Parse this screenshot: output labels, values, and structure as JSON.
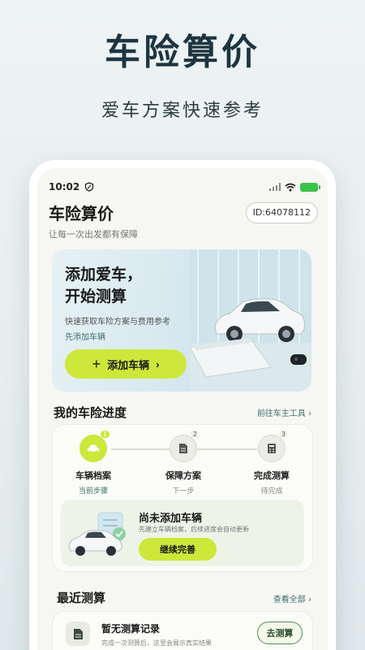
{
  "promo": {
    "title": "车险算价",
    "subtitle": "爱车方案快速参考"
  },
  "status_bar": {
    "time": "10:02"
  },
  "header": {
    "title": "车险算价",
    "id_badge": "ID:64078112",
    "subtitle": "让每一次出发都有保障"
  },
  "banner": {
    "title_line1": "添加爱车，",
    "title_line2": "开始测算",
    "description": "快速获取车险方案与费用参考",
    "link": "先添加车辆",
    "button_label": "添加车辆",
    "button_plus": "+",
    "button_chevron": "›"
  },
  "progress": {
    "section_title": "我的车险进度",
    "link": "前往车主工具 ›",
    "steps": [
      {
        "num": "1",
        "label": "车辆档案",
        "status": "当前步骤",
        "icon": "car-icon",
        "active": true
      },
      {
        "num": "2",
        "label": "保障方案",
        "status": "下一步",
        "icon": "document-icon",
        "active": false
      },
      {
        "num": "3",
        "label": "完成测算",
        "status": "待完成",
        "icon": "calculator-icon",
        "active": false
      }
    ],
    "empty": {
      "title": "尚未添加车辆",
      "description": "先建立车辆档案，后续进度会自动更新",
      "button_label": "继续完善"
    }
  },
  "recent": {
    "section_title": "最近测算",
    "link": "查看全部 ›",
    "empty_title": "暂无测算记录",
    "empty_description": "完成一次测算后，这里会展示真实结果",
    "button_label": "去测算"
  },
  "colors": {
    "accent": "#cde83a",
    "link": "#3d6e6e",
    "title": "#1e3540"
  }
}
